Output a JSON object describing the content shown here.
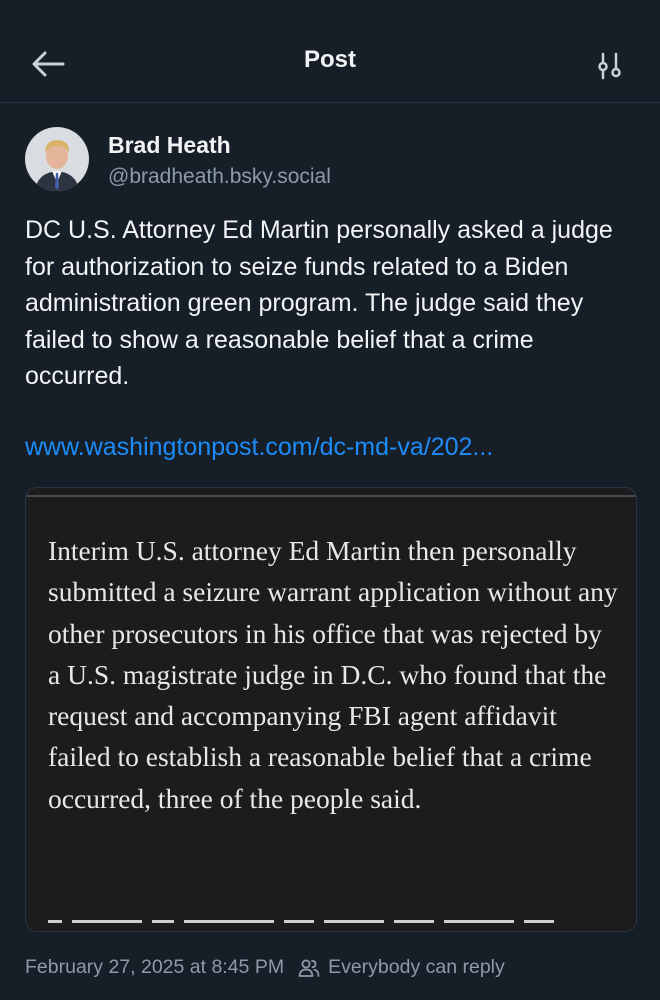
{
  "header": {
    "title": "Post",
    "back_icon": "arrow-left-icon",
    "filter_icon": "sliders-icon"
  },
  "author": {
    "name": "Brad Heath",
    "handle": "@bradheath.bsky.social"
  },
  "post": {
    "text": "DC U.S. Attorney Ed Martin personally asked a judge for authorization to seize funds related to a Biden administration green program. The judge said they failed to show a reasonable belief that a crime occurred.",
    "link": "www.washingtonpost.com/dc-md-va/202..."
  },
  "embed": {
    "text": "Interim U.S. attorney Ed Martin then personally submitted a seizure warrant application without any other prosecutors in his office that was rejected by a U.S. magistrate judge in D.C. who found that the request and accompanying FBI agent affidavit failed to establish a reasonable belief that a crime occurred, three of the people said."
  },
  "meta": {
    "timestamp": "February 27, 2025 at 8:45 PM",
    "reply_setting": "Everybody can reply",
    "reply_icon": "people-icon"
  },
  "colors": {
    "background": "#161e27",
    "link": "#1d8cf8",
    "muted": "#8d9aa8",
    "embed_bg": "#1c1c1e"
  }
}
